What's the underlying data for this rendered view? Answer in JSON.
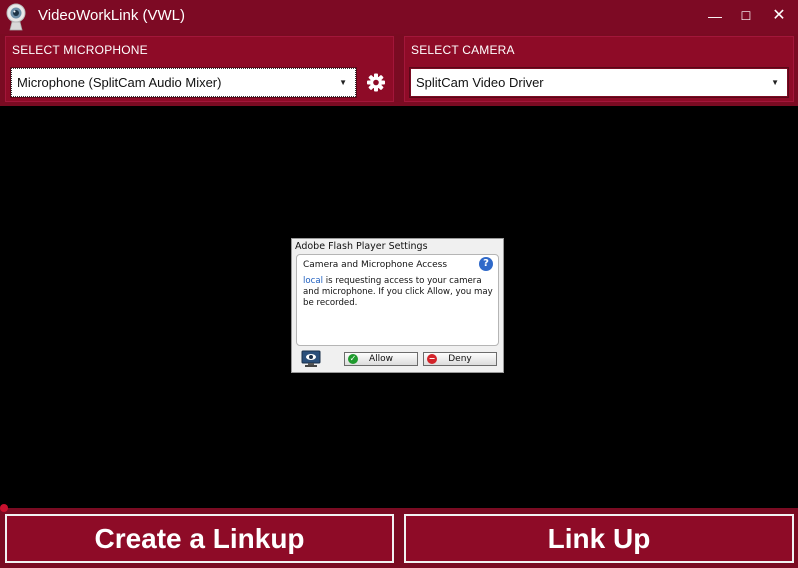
{
  "window": {
    "title": "VideoWorkLink (VWL)",
    "minimize_glyph": "—",
    "maximize_glyph": "☐",
    "close_glyph": "✕"
  },
  "microphone": {
    "label": "SELECT MICROPHONE",
    "selected": "Microphone (SplitCam Audio Mixer)",
    "settings_icon": "gear-icon"
  },
  "camera": {
    "label": "SELECT CAMERA",
    "selected": "SplitCam Video Driver"
  },
  "flash_dialog": {
    "title": "Adobe Flash Player Settings",
    "heading": "Camera and Microphone Access",
    "help_glyph": "?",
    "message_link": "local",
    "message_rest": " is requesting access to your camera and microphone. If you click Allow, you may be recorded.",
    "allow_label": "Allow",
    "deny_label": "Deny"
  },
  "actions": {
    "create_label": "Create a Linkup",
    "link_label": "Link Up"
  },
  "colors": {
    "brand": "#8e0b27",
    "titlebar": "#7d0a24",
    "video_bg": "#000000"
  }
}
